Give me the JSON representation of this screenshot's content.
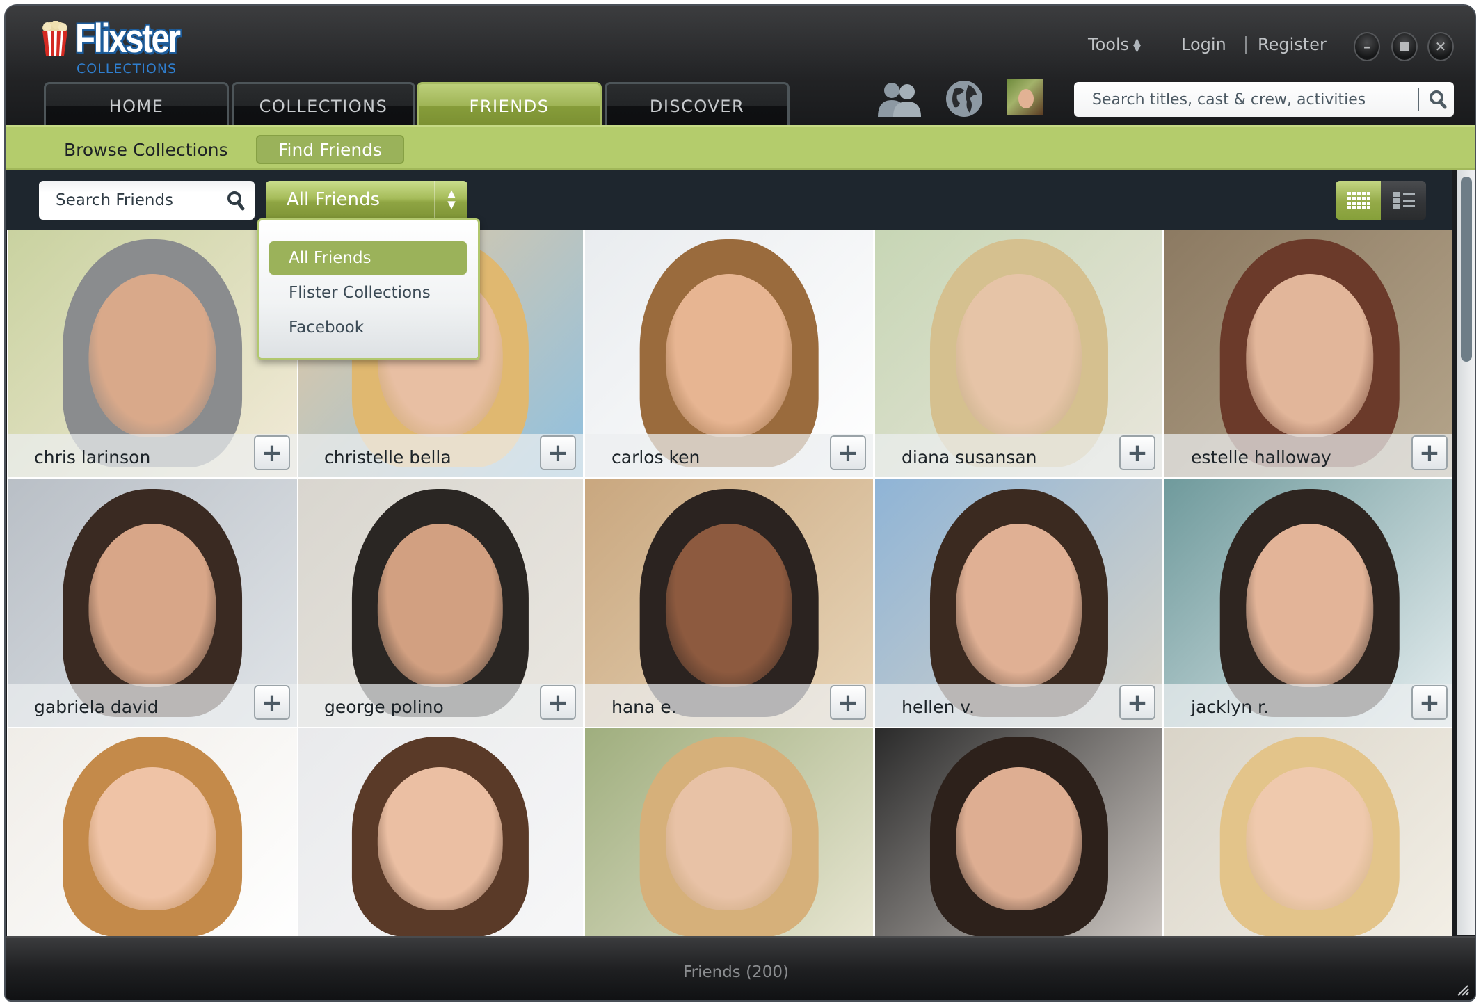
{
  "app": {
    "logo_word": "Flixster",
    "logo_sub": "COLLECTIONS"
  },
  "header": {
    "tools_label": "Tools",
    "login_label": "Login",
    "register_label": "Register",
    "search_placeholder": "Search titles, cast & crew, activities",
    "window_controls": [
      "minimize",
      "maximize",
      "close"
    ]
  },
  "tabs": [
    {
      "label": "HOME",
      "active": false
    },
    {
      "label": "COLLECTIONS",
      "active": false
    },
    {
      "label": "FRIENDS",
      "active": true
    },
    {
      "label": "DISCOVER",
      "active": false
    }
  ],
  "nav_icons": [
    "friends-icon",
    "globe-icon",
    "user-avatar"
  ],
  "subnav": [
    {
      "label": "Browse Collections",
      "active": false
    },
    {
      "label": "Find Friends",
      "active": true
    }
  ],
  "toolbar": {
    "search_placeholder": "Search Friends",
    "filter_selected": "All Friends",
    "view_mode": "grid"
  },
  "dropdown": {
    "options": [
      {
        "label": "All Friends",
        "selected": true
      },
      {
        "label": "Flister Collections",
        "selected": false
      },
      {
        "label": "Facebook",
        "selected": false
      }
    ]
  },
  "friends": [
    {
      "name": "chris larinson"
    },
    {
      "name": "christelle bella"
    },
    {
      "name": "carlos ken"
    },
    {
      "name": "diana susansan"
    },
    {
      "name": "estelle halloway"
    },
    {
      "name": "gabriela david"
    },
    {
      "name": "george polino"
    },
    {
      "name": "hana e."
    },
    {
      "name": "hellen v."
    },
    {
      "name": "jacklyn r."
    },
    {
      "name": ""
    },
    {
      "name": ""
    },
    {
      "name": ""
    },
    {
      "name": ""
    },
    {
      "name": ""
    }
  ],
  "add_label": "+",
  "footer": {
    "count_label": "Friends (200)"
  },
  "colors": {
    "accent_green": "#9bb25a",
    "subnav_green": "#b4cc6c",
    "header_dark": "#1a1c1f",
    "logo_blue": "#2f7fd0"
  }
}
